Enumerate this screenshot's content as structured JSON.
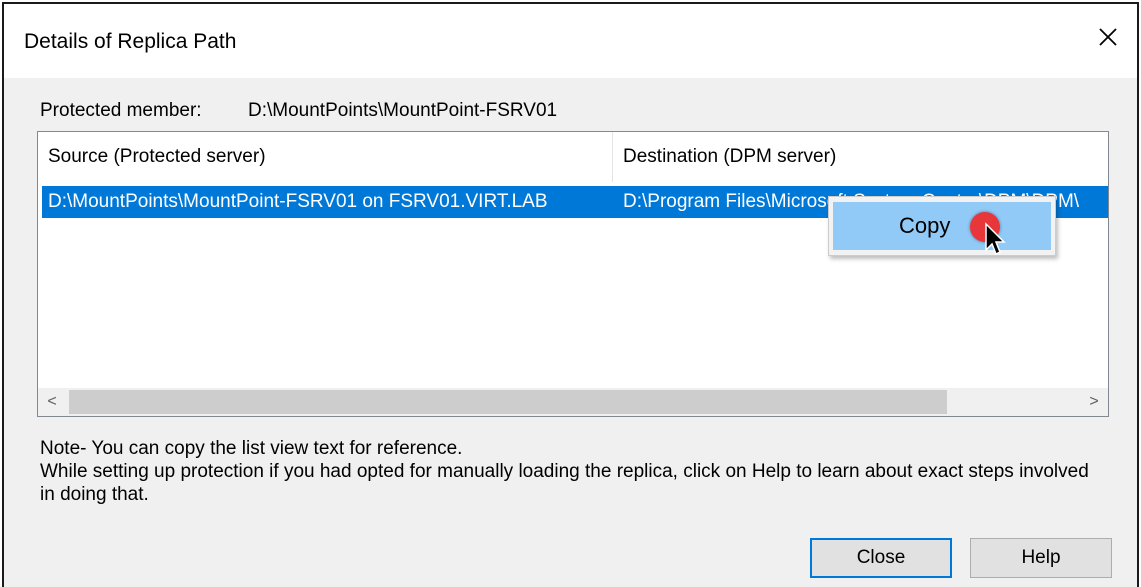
{
  "window": {
    "title": "Details of Replica Path",
    "close_icon": "close-icon"
  },
  "protected_member": {
    "label": "Protected member:",
    "value": "D:\\MountPoints\\MountPoint-FSRV01"
  },
  "list_view": {
    "columns": [
      "Source (Protected server)",
      "Destination (DPM server)"
    ],
    "rows": [
      {
        "source": "D:\\MountPoints\\MountPoint-FSRV01 on FSRV01.VIRT.LAB",
        "destination": "D:\\Program Files\\Microsoft System Center\\DPM\\DPM\\"
      }
    ],
    "selected_row_color": "#0078d7",
    "scroll_left": "<",
    "scroll_right": ">"
  },
  "context_menu": {
    "items": [
      "Copy"
    ],
    "highlight_color": "#91c9f7"
  },
  "note": {
    "line1": "Note- You can copy the list view text for reference.",
    "line2": "While setting up protection if you had opted for manually loading the replica, click on Help to learn about exact steps involved in doing that."
  },
  "buttons": {
    "close": "Close",
    "help": "Help"
  },
  "accent_color": "#0078d7",
  "click_marker_color": "#e8373b"
}
